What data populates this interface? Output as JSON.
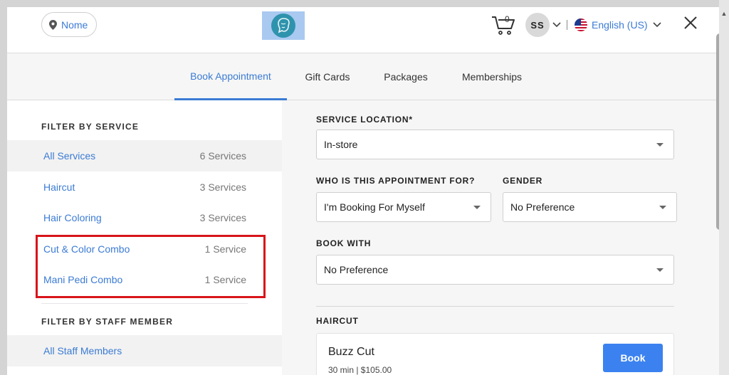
{
  "header": {
    "location_label": "Nome",
    "cart_count": "0",
    "user_initials": "SS",
    "language": "English (US)"
  },
  "tabs": [
    {
      "label": "Book Appointment",
      "active": true
    },
    {
      "label": "Gift Cards",
      "active": false
    },
    {
      "label": "Packages",
      "active": false
    },
    {
      "label": "Memberships",
      "active": false
    }
  ],
  "sidebar": {
    "service_heading": "FILTER BY SERVICE",
    "services": [
      {
        "label": "All Services",
        "count": "6 Services",
        "selected": true
      },
      {
        "label": "Haircut",
        "count": "3 Services"
      },
      {
        "label": "Hair Coloring",
        "count": "3 Services"
      },
      {
        "label": "Cut & Color Combo",
        "count": "1 Service"
      },
      {
        "label": "Mani Pedi Combo",
        "count": "1 Service"
      }
    ],
    "staff_heading": "FILTER BY STAFF MEMBER",
    "staff": [
      {
        "label": "All Staff Members",
        "selected": true
      }
    ]
  },
  "form": {
    "location_label": "SERVICE LOCATION*",
    "location_value": "In-store",
    "for_label": "WHO IS THIS APPOINTMENT FOR?",
    "for_value": "I'm Booking For Myself",
    "gender_label": "GENDER",
    "gender_value": "No Preference",
    "book_with_label": "BOOK WITH",
    "book_with_value": "No Preference"
  },
  "section": {
    "title": "HAIRCUT",
    "items": [
      {
        "name": "Buzz Cut",
        "meta": "30 min | $105.00",
        "button": "Book"
      }
    ]
  },
  "colors": {
    "accent": "#3b7bd4",
    "button": "#3b82f0",
    "highlight": "#d8141a"
  }
}
